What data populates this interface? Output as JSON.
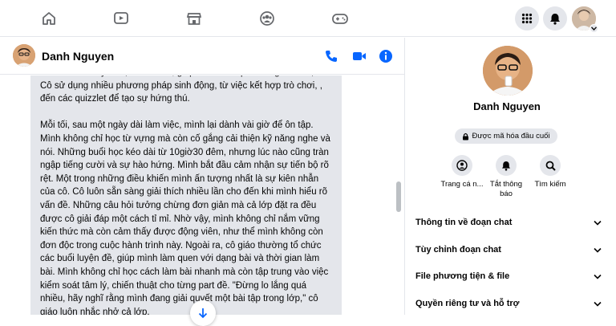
{
  "topnav": {
    "items": [
      "home-icon",
      "video-icon",
      "marketplace-icon",
      "groups-icon",
      "gaming-icon"
    ],
    "right": [
      "menu-grid-icon",
      "notifications-bell-icon",
      "profile-avatar"
    ]
  },
  "chat": {
    "contact_name": "Danh Nguyen",
    "paragraphs": [
      "đã khéo léo truyền đạt kiến thức, giúp mình làm quen từng chút một. Cô sử dụng nhiều phương pháp sinh động, từ việc kết hợp trò chơi, , đến các quizzlet để tạo sự hứng thú.",
      "Mỗi tối, sau một ngày dài làm việc, mình lại dành vài giờ để ôn tập. Mình không chỉ học từ vựng mà còn cố gắng cải thiện kỹ năng nghe và nói. Những buổi học kéo dài từ 10giờ30 đêm, nhưng lúc nào cũng tràn ngập tiếng cười và sự hào hứng. Mình bắt đầu cảm nhận sự tiến bộ rõ rệt.  Một trong những điều khiến mình ấn tượng nhất là sự kiên nhẫn của cô. Cô luôn sẵn sàng giải thích nhiều lần cho đến khi mình hiểu rõ vấn đề. Những câu hỏi tưởng chừng đơn giản mà cả lớp  đặt ra đều được cô giải đáp một cách tỉ mỉ. Nhờ vậy, mình không chỉ nắm vững kiến thức mà còn cảm thấy được động viên, như thể mình không còn đơn độc trong cuộc hành trình này. Ngoài ra, cô giáo thường tổ chức các buổi luyện đề, giúp mình làm quen với dạng bài và thời gian làm bài. Mình không chỉ học cách làm bài nhanh mà còn tập trung vào việc kiểm soát tâm lý, chiến thuật cho từng part đề. \"Đừng lo lắng quá nhiều, hãy nghĩ rằng mình đang giải quyết một bài tập trong lớp,\" cô giáo luôn nhắc nhở cả lớp."
    ]
  },
  "info": {
    "name": "Danh Nguyen",
    "encrypted_label": "Được mã hóa đầu cuối",
    "actions": [
      {
        "label": "Trang cá n...",
        "icon": "profile-icon"
      },
      {
        "label": "Tắt thông báo",
        "icon": "bell-icon"
      },
      {
        "label": "Tìm kiếm",
        "icon": "search-icon"
      }
    ],
    "sections": [
      "Thông tin về đoạn chat",
      "Tùy chỉnh đoạn chat",
      "File phương tiện & file",
      "Quyền riêng tư và hỗ trợ"
    ]
  },
  "colors": {
    "accent": "#0866ff",
    "bubble": "#e4e6eb",
    "divider": "#e4e6eb"
  }
}
